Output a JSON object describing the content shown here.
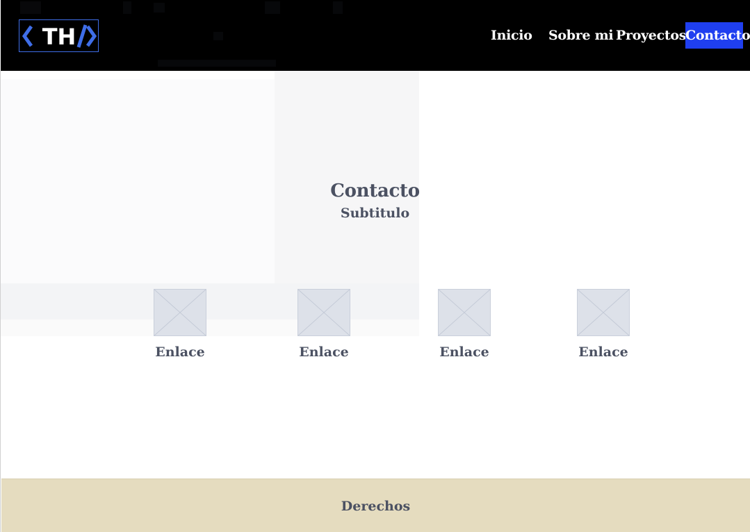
{
  "header": {
    "logo_text": "TH",
    "nav": [
      {
        "label": "Inicio",
        "active": false
      },
      {
        "label": "Sobre mi",
        "active": false
      },
      {
        "label": "Proyectos",
        "active": false
      },
      {
        "label": "Contacto",
        "active": true
      }
    ]
  },
  "main": {
    "title": "Contacto",
    "subtitle": "Subtitulo",
    "links": [
      {
        "label": "Enlace",
        "icon": "image-placeholder-icon"
      },
      {
        "label": "Enlace",
        "icon": "image-placeholder-icon"
      },
      {
        "label": "Enlace",
        "icon": "image-placeholder-icon"
      },
      {
        "label": "Enlace",
        "icon": "image-placeholder-icon"
      }
    ]
  },
  "footer": {
    "text": "Derechos"
  },
  "colors": {
    "header_bg": "#000000",
    "nav_active_bg": "#1f3ff0",
    "logo_accent": "#3f6ee8",
    "footer_bg": "#e5dcbf",
    "text": "#4b5162"
  }
}
